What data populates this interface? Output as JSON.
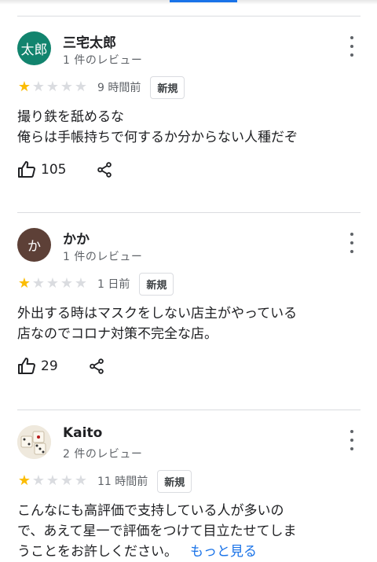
{
  "reviews": [
    {
      "avatar_text": "太郎",
      "avatar_color": "#12846e",
      "name": "三宅太郎",
      "review_count": "1 件のレビュー",
      "rating": 1,
      "time": "9 時間前",
      "badge": "新規",
      "text": "撮り鉄を舐めるな\n俺らは手帳持ちで何するか分からない人種だぞ",
      "likes": "105"
    },
    {
      "avatar_text": "か",
      "avatar_color": "#5d4037",
      "name": "かか",
      "review_count": "1 件のレビュー",
      "rating": 1,
      "time": "1 日前",
      "badge": "新規",
      "text": "外出する時はマスクをしない店主がやっている\n店なのでコロナ対策不完全な店。",
      "likes": "29"
    },
    {
      "avatar_text": "",
      "avatar_color": "#e8e2d6",
      "name": "Kaito",
      "review_count": "2 件のレビュー",
      "rating": 1,
      "time": "11 時間前",
      "badge": "新規",
      "text": "こんなにも高評価で支持している人が多いの\nで、あえて星一で評価をつけて目立たせてしま\nうことをお許しください。",
      "more_link": "もっと見る"
    }
  ],
  "icons": {
    "like": "thumbs-up-icon",
    "share": "share-icon",
    "menu": "more-vert-icon",
    "star": "star-icon"
  },
  "colors": {
    "star_on": "#fbbc04",
    "star_off": "#dadce0",
    "accent": "#1a73e8"
  }
}
